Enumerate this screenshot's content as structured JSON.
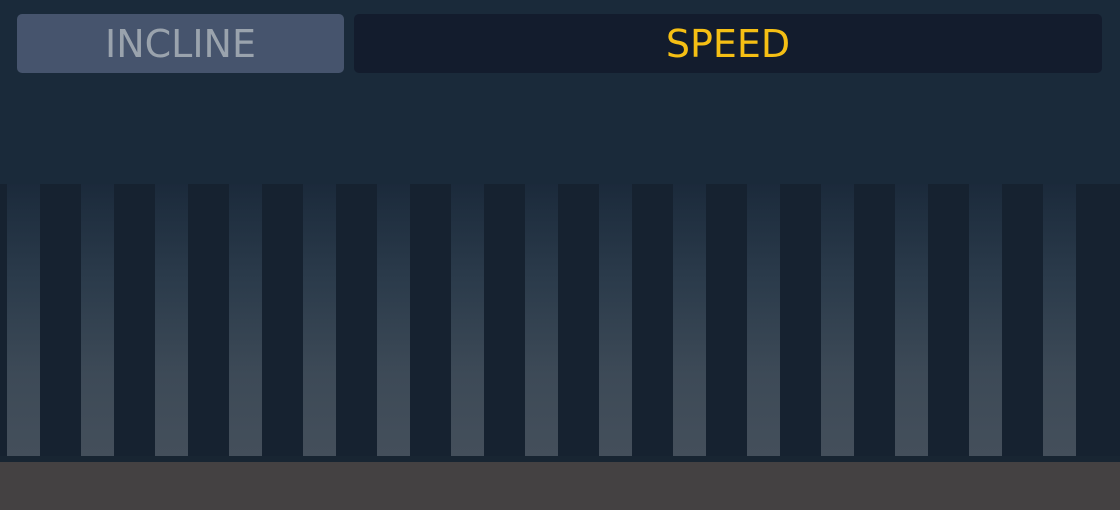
{
  "tabs": {
    "incline": {
      "label": "INCLINE",
      "state": "inactive",
      "bg": "#46546d",
      "color": "#9aa3ad"
    },
    "speed": {
      "label": "SPEED",
      "state": "active",
      "bg": "#131c2d",
      "color": "#f5bf14"
    }
  },
  "colors": {
    "background": "#1a2a3a",
    "bar_top": "#1b2a3b",
    "bar_bottom": "#444f5b",
    "footer": "#444142"
  }
}
